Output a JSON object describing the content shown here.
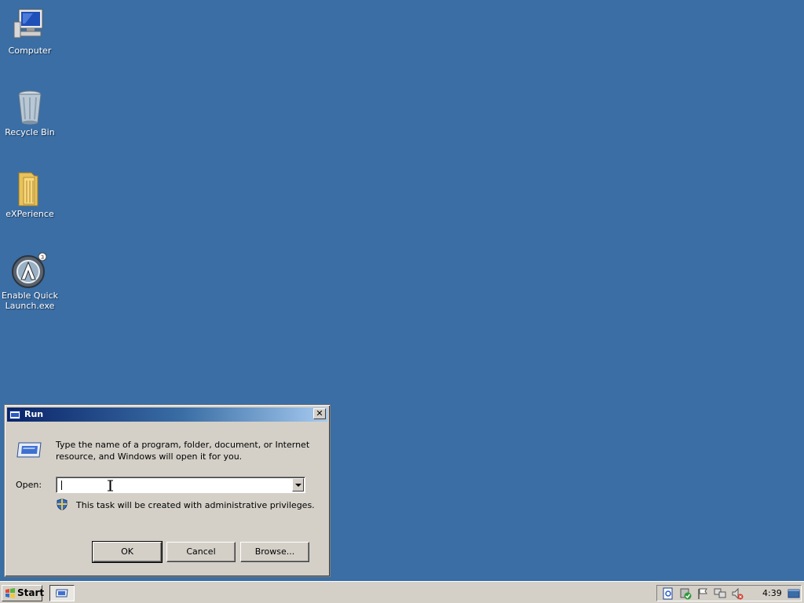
{
  "desktop": {
    "icons": [
      {
        "label": "Computer",
        "icon": "computer-icon"
      },
      {
        "label": "Recycle Bin",
        "icon": "recycle-bin-icon"
      },
      {
        "label": "eXPerience",
        "icon": "folder-icon"
      },
      {
        "label_line1": "Enable Quick",
        "label_line2": "Launch.exe",
        "icon": "app-icon"
      }
    ]
  },
  "run_dialog": {
    "title": "Run",
    "description": "Type the name of a program, folder, document, or Internet resource, and Windows will open it for you.",
    "open_label": "Open:",
    "open_value": "",
    "admin_note": "This task will be created with administrative privileges.",
    "ok_label": "OK",
    "cancel_label": "Cancel",
    "browse_label": "Browse..."
  },
  "taskbar": {
    "start_label": "Start",
    "clock": "4:39"
  },
  "colors": {
    "desktop": "#3a6ea5",
    "titlebar_start": "#0a246a",
    "titlebar_end": "#a6caf0",
    "face": "#d4d0c8"
  }
}
